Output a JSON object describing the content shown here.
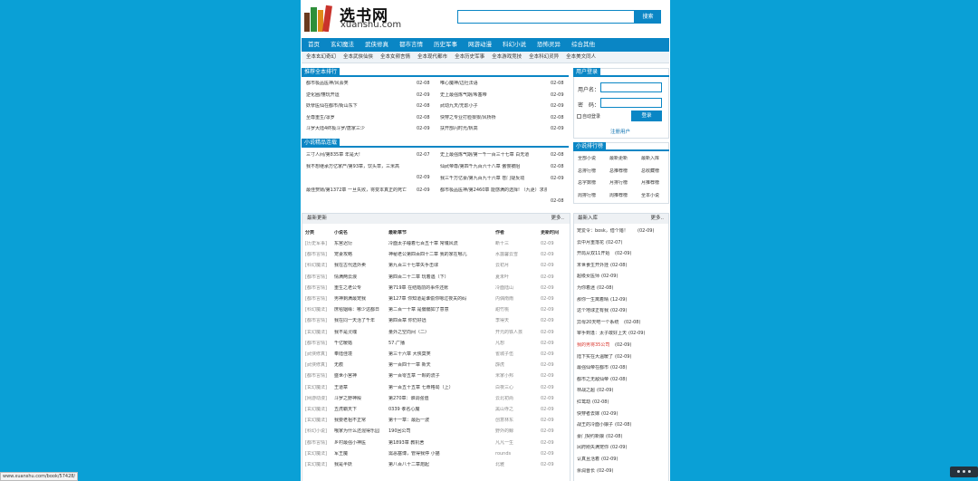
{
  "header": {
    "logo_cn": "选书网",
    "logo_en": "xuanshu.com",
    "search_button": "搜索"
  },
  "nav": [
    "首页",
    "玄幻魔法",
    "武侠修真",
    "都市言情",
    "历史军事",
    "网游动漫",
    "科幻小说",
    "恐怖灵异",
    "综合其他"
  ],
  "subnav": [
    "全本玄幻奇幻",
    "全本武侠仙侠",
    "全本女频言情",
    "全本现代都市",
    "全本历史军事",
    "全本游戏竞技",
    "全本科幻灵异",
    "全本美文同人"
  ],
  "full_rank": {
    "title": "推荐全本排行",
    "left": [
      [
        "都市极品医神/风会笑",
        "02-08"
      ],
      [
        "逆化圈/懂玩开运",
        "02-09"
      ],
      [
        "妖孽医仙在都市/街山东下",
        "02-08"
      ],
      [
        "至尊重生/凛罗",
        "02-08"
      ],
      [
        "斗罗大陆4终极斗罗/唐家三少",
        "02-09"
      ]
    ],
    "right": [
      [
        "唯心魔神/边社法语",
        "02-08"
      ],
      [
        "史上最强炼气期/希塞帝",
        "02-09"
      ],
      [
        "武动九天/无影小子",
        "02-09"
      ],
      [
        "快穿之专业打脸狠狠/风桥桥",
        "02-08"
      ],
      [
        "扶开部闪时光/帆高",
        "02-09"
      ]
    ]
  },
  "fine": {
    "title": "小说精品连载",
    "rows": [
      [
        "三寸人间/第835章 年是大!",
        "02-07",
        "史上最强炼气期/第一千一百三十七章 白无道",
        "02-08"
      ],
      [
        "我不想继承万亿家产/第93章，饮头草，三米高",
        "02-09",
        "仙武帝尊/第四千九百六十八章 傲慢被阻",
        "02-08"
      ],
      [
        "",
        "",
        "我三千万亿豪/第九百九十六章 苍门疑反动",
        "02-09"
      ],
      [
        "最佳赘婿/第1372章 一旦失败，将变本真正的死亡",
        "02-09",
        "都市极品医神/第2460章 能感满的选择! （九更）求票!",
        "02-08"
      ]
    ]
  },
  "login": {
    "title": "用户登录",
    "username_label": "用户名：",
    "password_label": "密　码：",
    "remember_label": "自动登录",
    "login_button": "登录",
    "register_link": "注册用户"
  },
  "rank": {
    "title": "小说排行榜",
    "items": [
      "全部小说",
      "最新更新",
      "最新入库",
      "总排行榜",
      "总推荐榜",
      "总收藏榜",
      "总字数榜",
      "月排行榜",
      "月推荐榜",
      "周排行榜",
      "周推荐榜",
      "全本小说"
    ]
  },
  "latest": {
    "title": "最新更新",
    "more": "更多..",
    "headers": [
      "分类",
      "小说名",
      "最新章节",
      "作者",
      "更新时间"
    ],
    "rows": [
      [
        "[历史军事]",
        "东宫迟衍",
        "冷面太子睡着七百五十章 常魂风流",
        "断十三",
        "02-09"
      ],
      [
        "[都市言情]",
        "宠妻攻略",
        "神秘老公第四百四十二章 我的家在哪儿",
        "水露馨云雪",
        "02-09"
      ],
      [
        "[科幻魔法]",
        "我在古代选外卖",
        "第九百三十七章失手击球",
        "云初月",
        "02-09"
      ],
      [
        "[都市言情]",
        "情满两云浪",
        "第四百二十二章 玩着遇（下）",
        "夏未叶",
        "02-09"
      ],
      [
        "[都市言情]",
        "重生之老公专",
        "第719章 在结婚前的事件还账",
        "冷面陆山",
        "02-09"
      ],
      [
        "[都市言情]",
        "男神剩满最宠我",
        "第127章 你知道是谁偷你嗯过夜关的码",
        "内偶南雨",
        "02-09"
      ],
      [
        "[科幻魔法]",
        "庶毯姻缘：哪少这都日",
        "第二百一十章 是偏偏如了意意",
        "甜竹桃",
        "02-09"
      ],
      [
        "[都市言情]",
        "我在同一天活了千年",
        "第四百章 你仍好远",
        "李得天",
        "02-09"
      ],
      [
        "[玄幻魔法]",
        "我不是灵魂",
        "量外之空向间（二）",
        "开元的铁人孩",
        "02-09"
      ],
      [
        "[都市言情]",
        "千亿暖婚",
        "57.广播",
        "凡想",
        "02-09"
      ],
      [
        "[武侠修真]",
        "奉陆佳境",
        "第三十六章 大侠莫笑",
        "雀城子伍",
        "02-09"
      ],
      [
        "[武侠修真]",
        "无痕",
        "第一百四十一章 新天",
        "霹虎",
        "02-09"
      ],
      [
        "[都市言情]",
        "盛世小宫神",
        "第一百零五章 一颗的流子",
        "米家小邦",
        "02-09"
      ],
      [
        "[玄幻魔法]",
        "王道章",
        "第一百五十五章 七命格局（上）",
        "白夜三心",
        "02-09"
      ],
      [
        "[网游动漫]",
        "斗罗之野神殿",
        "第270章：谁调强值",
        "云北初尚",
        "02-09"
      ],
      [
        "[玄幻魔法]",
        "五虎霸天下",
        "0339 孝名心魔",
        "黑山寺之",
        "02-09"
      ],
      [
        "[玄幻魔法]",
        "我要老祖不正常",
        "第十一章：最后一波",
        "创意林东",
        "02-09"
      ],
      [
        "[科幻小说]",
        "哦家为什么还混得乐园",
        "190回公司",
        "野外的鲸",
        "02-09"
      ],
      [
        "[都市言情]",
        "乡村最强小神医",
        "第1893章 教机舍",
        "凡凡一生",
        "02-09"
      ],
      [
        "[玄幻魔法]",
        "军王魔",
        "需恶塞博，管得我停 小猫",
        "rounds",
        "02-09"
      ],
      [
        "[玄幻魔法]",
        "我是半妖",
        "第八百八十二章炮起",
        "北雅",
        "02-09"
      ]
    ]
  },
  "newbooks": {
    "title": "最新入库",
    "more": "更多..",
    "rows": [
      [
        "宠爱令：bosk，借个婚！",
        "(02-09)"
      ],
      [
        "云中月重落花",
        "(02-07)"
      ],
      [
        "开局从双11开始",
        "(02-09)"
      ],
      [
        "末世食生开外挂",
        "(02-08)"
      ],
      [
        "超级女医师",
        "(02-09)"
      ],
      [
        "为你着迷",
        "(02-08)"
      ],
      [
        "那你一生离着晴",
        "(12-09)"
      ],
      [
        "这个地球正有我",
        "(02-09)"
      ],
      [
        "异母20天吧一个系统",
        "(02-08)"
      ],
      [
        "宰手到逢：太子敢好上天",
        "(02-09)"
      ],
      [
        "我的男将35公司",
        "(02-09)"
      ],
      [
        "陆下实在大温暖了",
        "(02-09)"
      ],
      [
        "最强仙帝在都市",
        "(02-08)"
      ],
      [
        "都市之无敌仙帝",
        "(02-08)"
      ],
      [
        "林战之超",
        "(02-09)"
      ],
      [
        "红鸾劫",
        "(02-08)"
      ],
      [
        "快穿者去嫁",
        "(02-09)"
      ],
      [
        "战王的冷面小娘子",
        "(02-08)"
      ],
      [
        "豪门契约新娘",
        "(02-08)"
      ],
      [
        "凤府刚失满宠你",
        "(02-09)"
      ],
      [
        "认真且活着",
        "(02-09)"
      ],
      [
        "余润晋长",
        "(02-09)"
      ]
    ]
  },
  "status_url": "www.xuanshu.com/book/57428/",
  "colors": {
    "brand": "#0a86c5",
    "page_bg": "#0aa0d6",
    "red_link": "#d9352c"
  }
}
